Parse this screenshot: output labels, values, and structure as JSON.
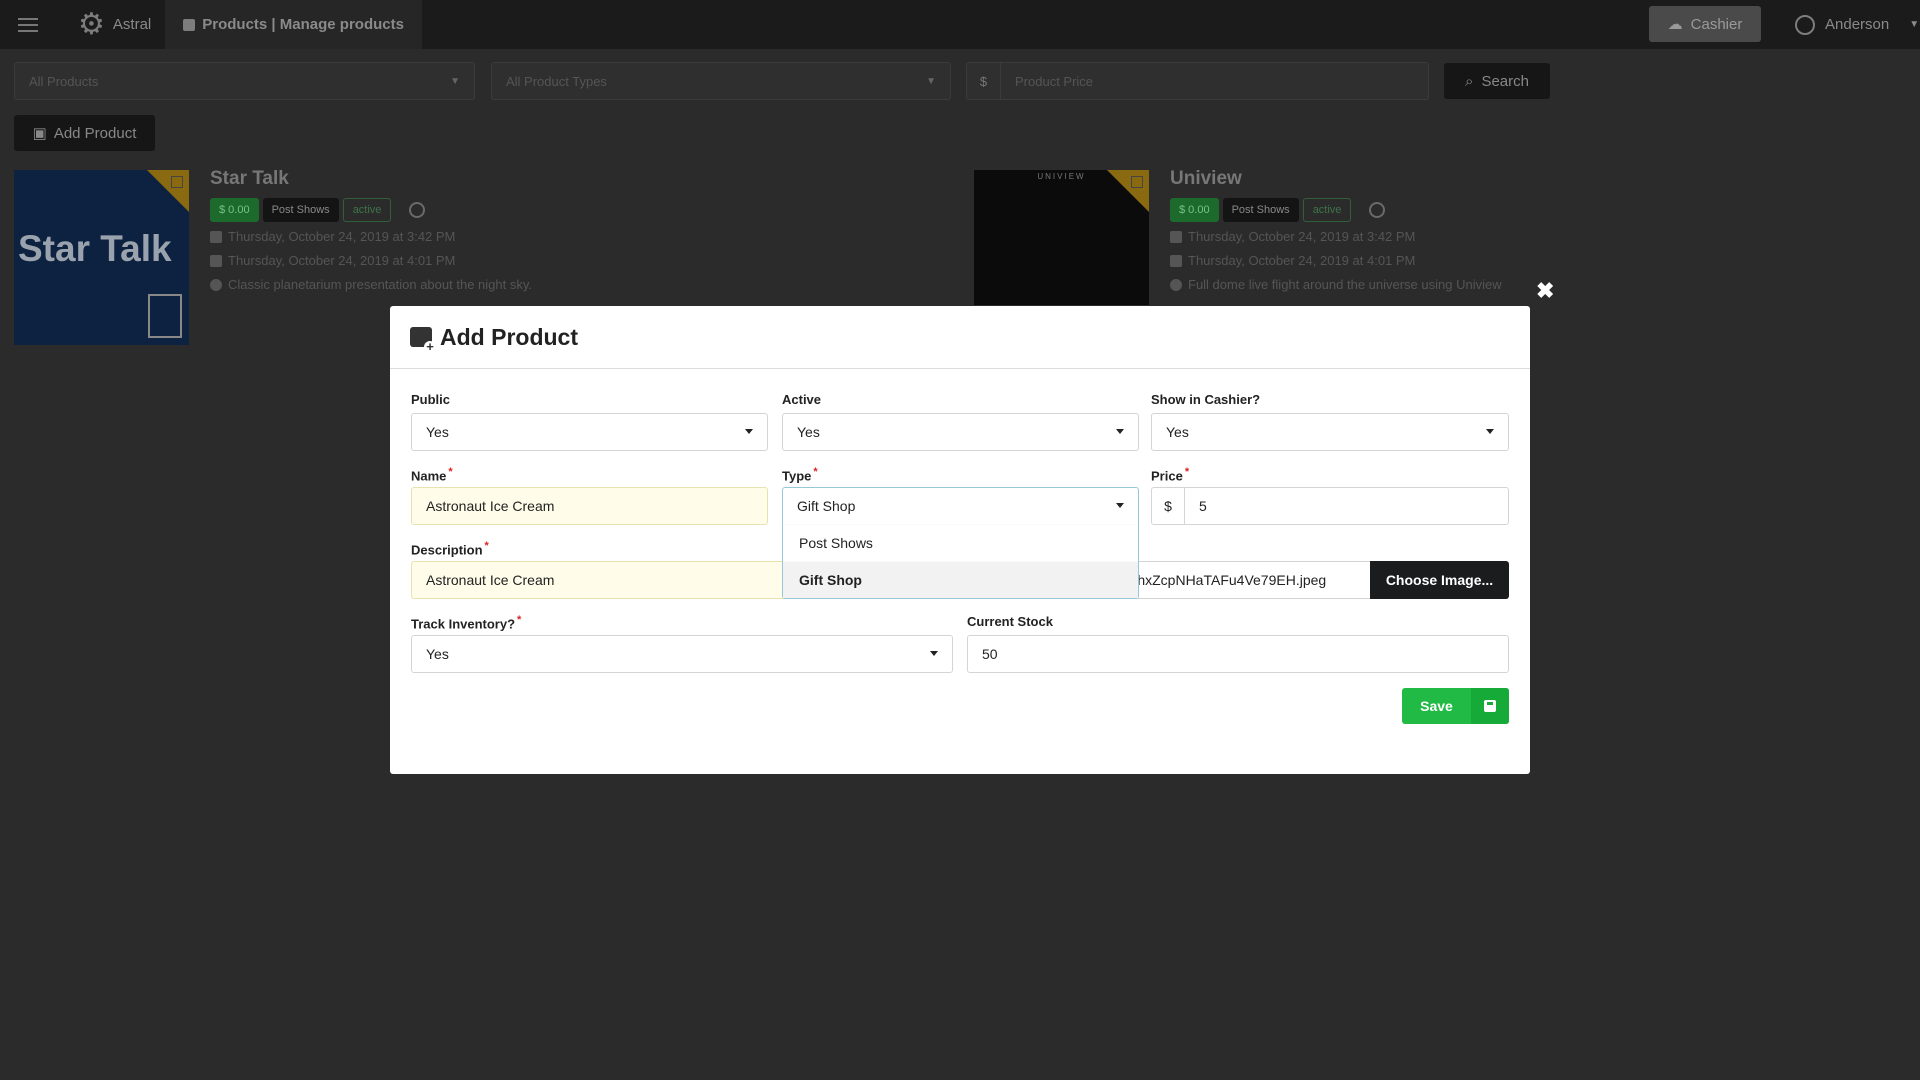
{
  "app": {
    "name": "Astral",
    "breadcrumb": "Products | Manage products"
  },
  "topbar": {
    "cashier_label": "Cashier",
    "user_name": "Anderson"
  },
  "filters": {
    "products_placeholder": "All Products",
    "types_placeholder": "All Product Types",
    "price_currency": "$",
    "price_placeholder": "Product Price",
    "search_label": "Search"
  },
  "add_product_label": "Add Product",
  "products": [
    {
      "title": "Star Talk",
      "image_text": "Star Talk",
      "price": "$ 0.00",
      "type": "Post Shows",
      "status": "active",
      "created": "Thursday, October 24, 2019 at 3:42 PM",
      "updated": "Thursday, October 24, 2019 at 4:01 PM",
      "description": "Classic planetarium presentation about the night sky."
    },
    {
      "title": "Uniview",
      "image_text": "UNIVIEW",
      "price": "$ 0.00",
      "type": "Post Shows",
      "status": "active",
      "created": "Thursday, October 24, 2019 at 3:42 PM",
      "updated": "Thursday, October 24, 2019 at 4:01 PM",
      "description": "Full dome live flight around the universe using Uniview"
    }
  ],
  "modal": {
    "title": "Add Product",
    "close_symbol": "✖",
    "fields": {
      "public": {
        "label": "Public",
        "value": "Yes"
      },
      "active": {
        "label": "Active",
        "value": "Yes"
      },
      "show_in_cashier": {
        "label": "Show in Cashier?",
        "value": "Yes"
      },
      "name": {
        "label": "Name",
        "required": "*",
        "value": "Astronaut Ice Cream"
      },
      "type": {
        "label": "Type",
        "required": "*",
        "value": "Gift Shop",
        "options": [
          "Post Shows",
          "Gift Shop"
        ]
      },
      "price": {
        "label": "Price",
        "required": "*",
        "currency": "$",
        "value": "5"
      },
      "description": {
        "label": "Description",
        "required": "*",
        "value": "Astronaut Ice Cream"
      },
      "image": {
        "file_name": "YhxZcpNHaTAFu4Ve79EH.jpeg",
        "button_label": "Choose Image..."
      },
      "track_inventory": {
        "label": "Track Inventory?",
        "required": "*",
        "value": "Yes"
      },
      "current_stock": {
        "label": "Current Stock",
        "value": "50"
      }
    },
    "save_label": "Save"
  }
}
